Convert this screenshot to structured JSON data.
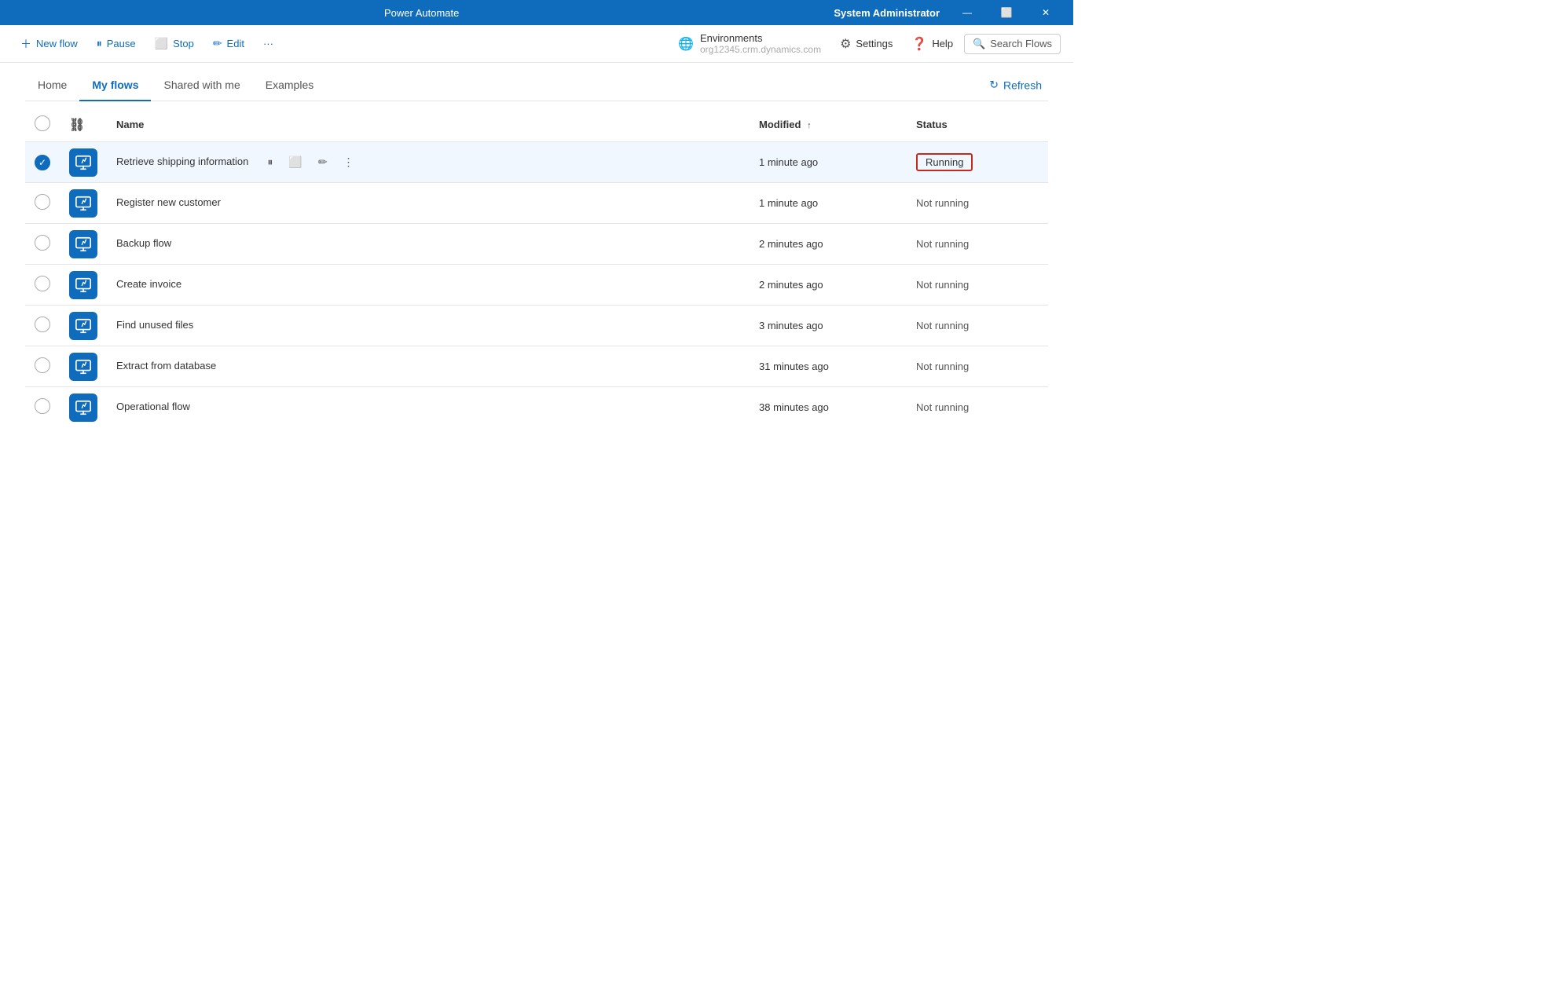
{
  "titleBar": {
    "title": "Power Automate",
    "user": "System Administrator",
    "minimizeIcon": "—",
    "restoreIcon": "⬜",
    "closeIcon": "✕"
  },
  "toolbar": {
    "newFlowLabel": "New flow",
    "pauseLabel": "Pause",
    "stopLabel": "Stop",
    "editLabel": "Edit",
    "moreLabel": "···",
    "environments": {
      "label": "Environments",
      "value": "org12345.crm.dynamics.com"
    },
    "settingsLabel": "Settings",
    "helpLabel": "Help",
    "searchLabel": "Search Flows"
  },
  "nav": {
    "tabs": [
      {
        "id": "home",
        "label": "Home",
        "active": false
      },
      {
        "id": "my-flows",
        "label": "My flows",
        "active": true
      },
      {
        "id": "shared",
        "label": "Shared with me",
        "active": false
      },
      {
        "id": "examples",
        "label": "Examples",
        "active": false
      }
    ],
    "refreshLabel": "Refresh"
  },
  "table": {
    "columns": {
      "name": "Name",
      "modified": "Modified",
      "modifiedSort": "↑",
      "status": "Status"
    },
    "flows": [
      {
        "id": 1,
        "name": "Retrieve shipping information",
        "modified": "1 minute ago",
        "status": "Running",
        "selected": true,
        "statusType": "running"
      },
      {
        "id": 2,
        "name": "Register new customer",
        "modified": "1 minute ago",
        "status": "Not running",
        "selected": false,
        "statusType": "not-running"
      },
      {
        "id": 3,
        "name": "Backup flow",
        "modified": "2 minutes ago",
        "status": "Not running",
        "selected": false,
        "statusType": "not-running"
      },
      {
        "id": 4,
        "name": "Create invoice",
        "modified": "2 minutes ago",
        "status": "Not running",
        "selected": false,
        "statusType": "not-running"
      },
      {
        "id": 5,
        "name": "Find unused files",
        "modified": "3 minutes ago",
        "status": "Not running",
        "selected": false,
        "statusType": "not-running"
      },
      {
        "id": 6,
        "name": "Extract from database",
        "modified": "31 minutes ago",
        "status": "Not running",
        "selected": false,
        "statusType": "not-running"
      },
      {
        "id": 7,
        "name": "Operational flow",
        "modified": "38 minutes ago",
        "status": "Not running",
        "selected": false,
        "statusType": "not-running"
      }
    ]
  }
}
